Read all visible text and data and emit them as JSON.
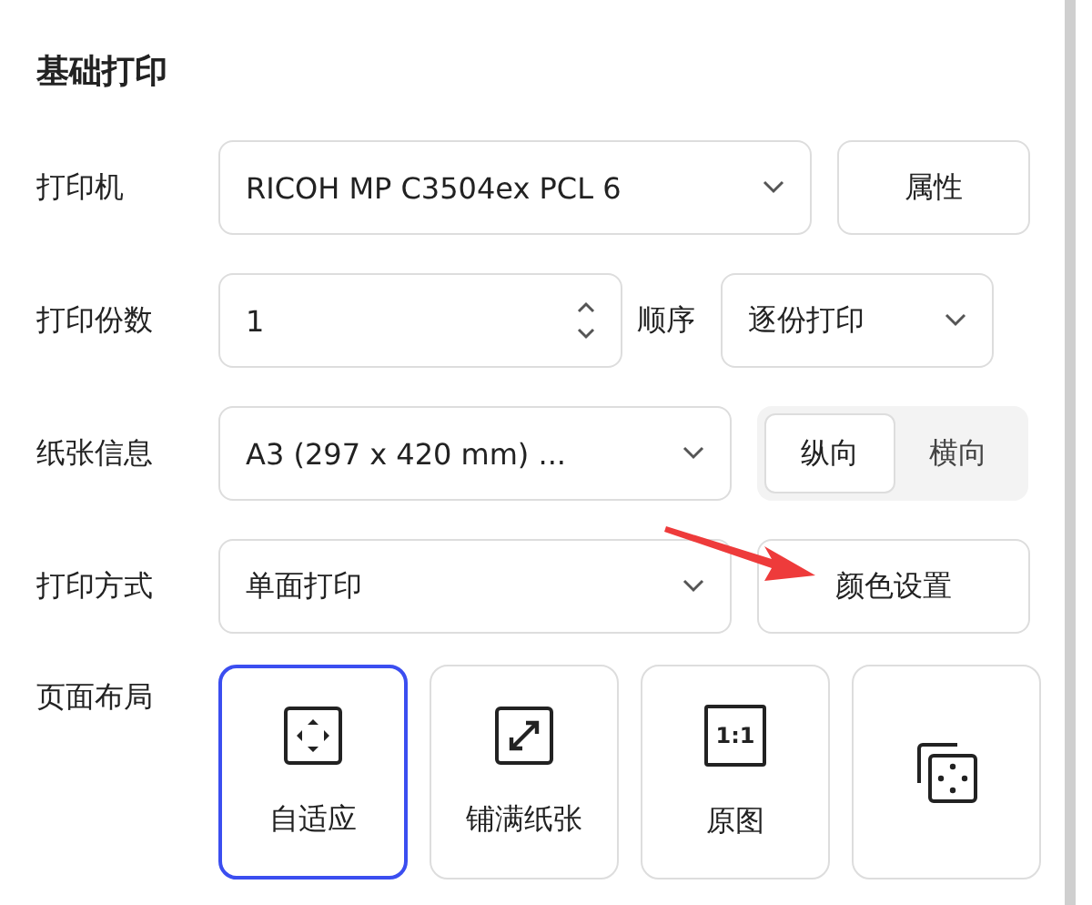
{
  "section_title": "基础打印",
  "printer": {
    "label": "打印机",
    "value": "RICOH MP C3504ex PCL 6",
    "button": "属性"
  },
  "copies": {
    "label": "打印份数",
    "value": "1",
    "order_label": "顺序",
    "order_value": "逐份打印"
  },
  "paper": {
    "label": "纸张信息",
    "value": "A3 (297 x 420 mm) ...",
    "orientations": [
      {
        "label": "纵向",
        "selected": true
      },
      {
        "label": "横向",
        "selected": false
      }
    ]
  },
  "print_mode": {
    "label": "打印方式",
    "value": "单面打印",
    "button": "颜色设置"
  },
  "layout": {
    "label": "页面布局",
    "options": [
      {
        "kind": "fit",
        "label": "自适应",
        "selected": true
      },
      {
        "kind": "fill",
        "label": "铺满纸张",
        "selected": false
      },
      {
        "kind": "original",
        "icon_text": "1:1",
        "label": "原图",
        "selected": false
      },
      {
        "kind": "multi",
        "selected": false
      }
    ]
  }
}
